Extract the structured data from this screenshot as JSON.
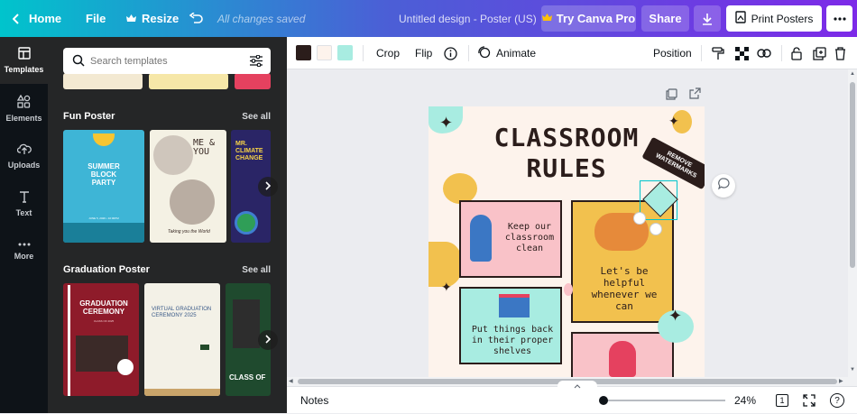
{
  "topbar": {
    "home": "Home",
    "file": "File",
    "resize": "Resize",
    "saved_status": "All changes saved",
    "doc_title": "Untitled design - Poster (US)",
    "try_pro": "Try Canva Pro",
    "share": "Share",
    "print": "Print Posters"
  },
  "rail": {
    "items": [
      {
        "label": "Templates",
        "icon": "templates-icon"
      },
      {
        "label": "Elements",
        "icon": "elements-icon"
      },
      {
        "label": "Uploads",
        "icon": "uploads-icon"
      },
      {
        "label": "Text",
        "icon": "text-icon"
      },
      {
        "label": "More",
        "icon": "more-icon"
      }
    ]
  },
  "panel": {
    "search_placeholder": "Search templates",
    "sections": [
      {
        "title": "Fun Poster",
        "see_all": "See all",
        "thumbs": [
          {
            "title": "SUMMER BLOCK PARTY",
            "date": "JUNE 5, 2026 • 10:00PM"
          },
          {
            "title": "ME & YOU",
            "tagline": "Taking you the World"
          },
          {
            "title": "MR. CLIMATE CHANGE"
          }
        ]
      },
      {
        "title": "Graduation Poster",
        "see_all": "See all",
        "thumbs": [
          {
            "title": "GRADUATION CEREMONY",
            "sub": "CLASS OF 2025"
          },
          {
            "title": "VIRTUAL GRADUATION CEREMONY 2025"
          },
          {
            "title": "CLASS OF"
          }
        ]
      }
    ]
  },
  "toolbar": {
    "colors": [
      "#2b1d1b",
      "#fdf3ec",
      "#a8ece1"
    ],
    "crop": "Crop",
    "flip": "Flip",
    "animate": "Animate",
    "position": "Position"
  },
  "poster": {
    "title_line1": "CLASSROOM",
    "title_line2": "RULES",
    "rules": [
      {
        "text": "Keep our classroom clean"
      },
      {
        "text": "Let's be helpful whenever we can"
      },
      {
        "text": "Put things back in their proper shelves"
      }
    ],
    "watermark": "REMOVE WATERMARKS",
    "colors": {
      "pink": "#f9c2c8",
      "yellow": "#f2c14e",
      "teal": "#a8ece1"
    }
  },
  "bottom": {
    "notes": "Notes",
    "zoom": "24%",
    "page_number": "1",
    "help": "?"
  }
}
